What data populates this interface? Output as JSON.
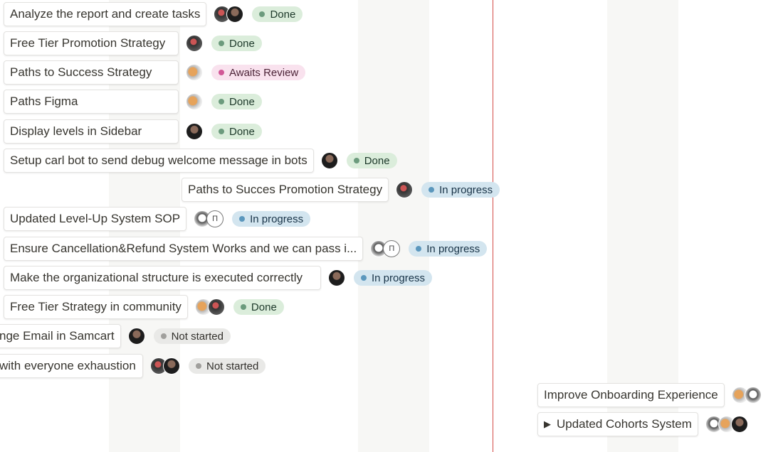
{
  "today_line_color": "#d44c47",
  "tasks": [
    {
      "title": "Analyze the report and create tasks",
      "avatars": [
        "mix",
        "dark"
      ],
      "status": "Done"
    },
    {
      "title": "Free Tier Promotion Strategy",
      "avatars": [
        "mix"
      ],
      "status": "Done"
    },
    {
      "title": "Paths to Success Strategy",
      "avatars": [
        "cat"
      ],
      "status": "Awaits Review"
    },
    {
      "title": "Paths Figma",
      "avatars": [
        "cat"
      ],
      "status": "Done"
    },
    {
      "title": "Display levels in Sidebar",
      "avatars": [
        "dark"
      ],
      "status": "Done"
    },
    {
      "title": "Setup carl bot to send debug welcome message in bots",
      "avatars": [
        "dark"
      ],
      "status": "Done"
    },
    {
      "title": "Paths to Succes Promotion Strategy",
      "avatars": [
        "mix"
      ],
      "status": "In progress"
    },
    {
      "title": "Updated Level-Up System SOP",
      "avatars": [
        "sketch",
        "letter"
      ],
      "avatar_letter": "П",
      "status": "In progress"
    },
    {
      "title": "Ensure Cancellation&Refund System Works and we can pass i...",
      "avatars": [
        "sketch",
        "letter"
      ],
      "avatar_letter": "П",
      "status": "In progress"
    },
    {
      "title": "Make the organizational structure is executed correctly",
      "avatars": [
        "dark"
      ],
      "status": "In progress"
    },
    {
      "title": "Free Tier Strategy in community",
      "avatars": [
        "cat",
        "mix"
      ],
      "status": "Done"
    },
    {
      "title": "nge Email in Samcart",
      "avatars": [
        "dark"
      ],
      "status": "Not started"
    },
    {
      "title": "with everyone exhaustion",
      "avatars": [
        "mix",
        "dark"
      ],
      "status": "Not started"
    },
    {
      "title": "Improve Onboarding Experience",
      "avatars": [
        "cat",
        "sketch"
      ],
      "status": ""
    },
    {
      "title": "Updated Cohorts System",
      "toggle": "▶",
      "avatars": [
        "sketch",
        "cat",
        "dark"
      ],
      "status": ""
    }
  ]
}
